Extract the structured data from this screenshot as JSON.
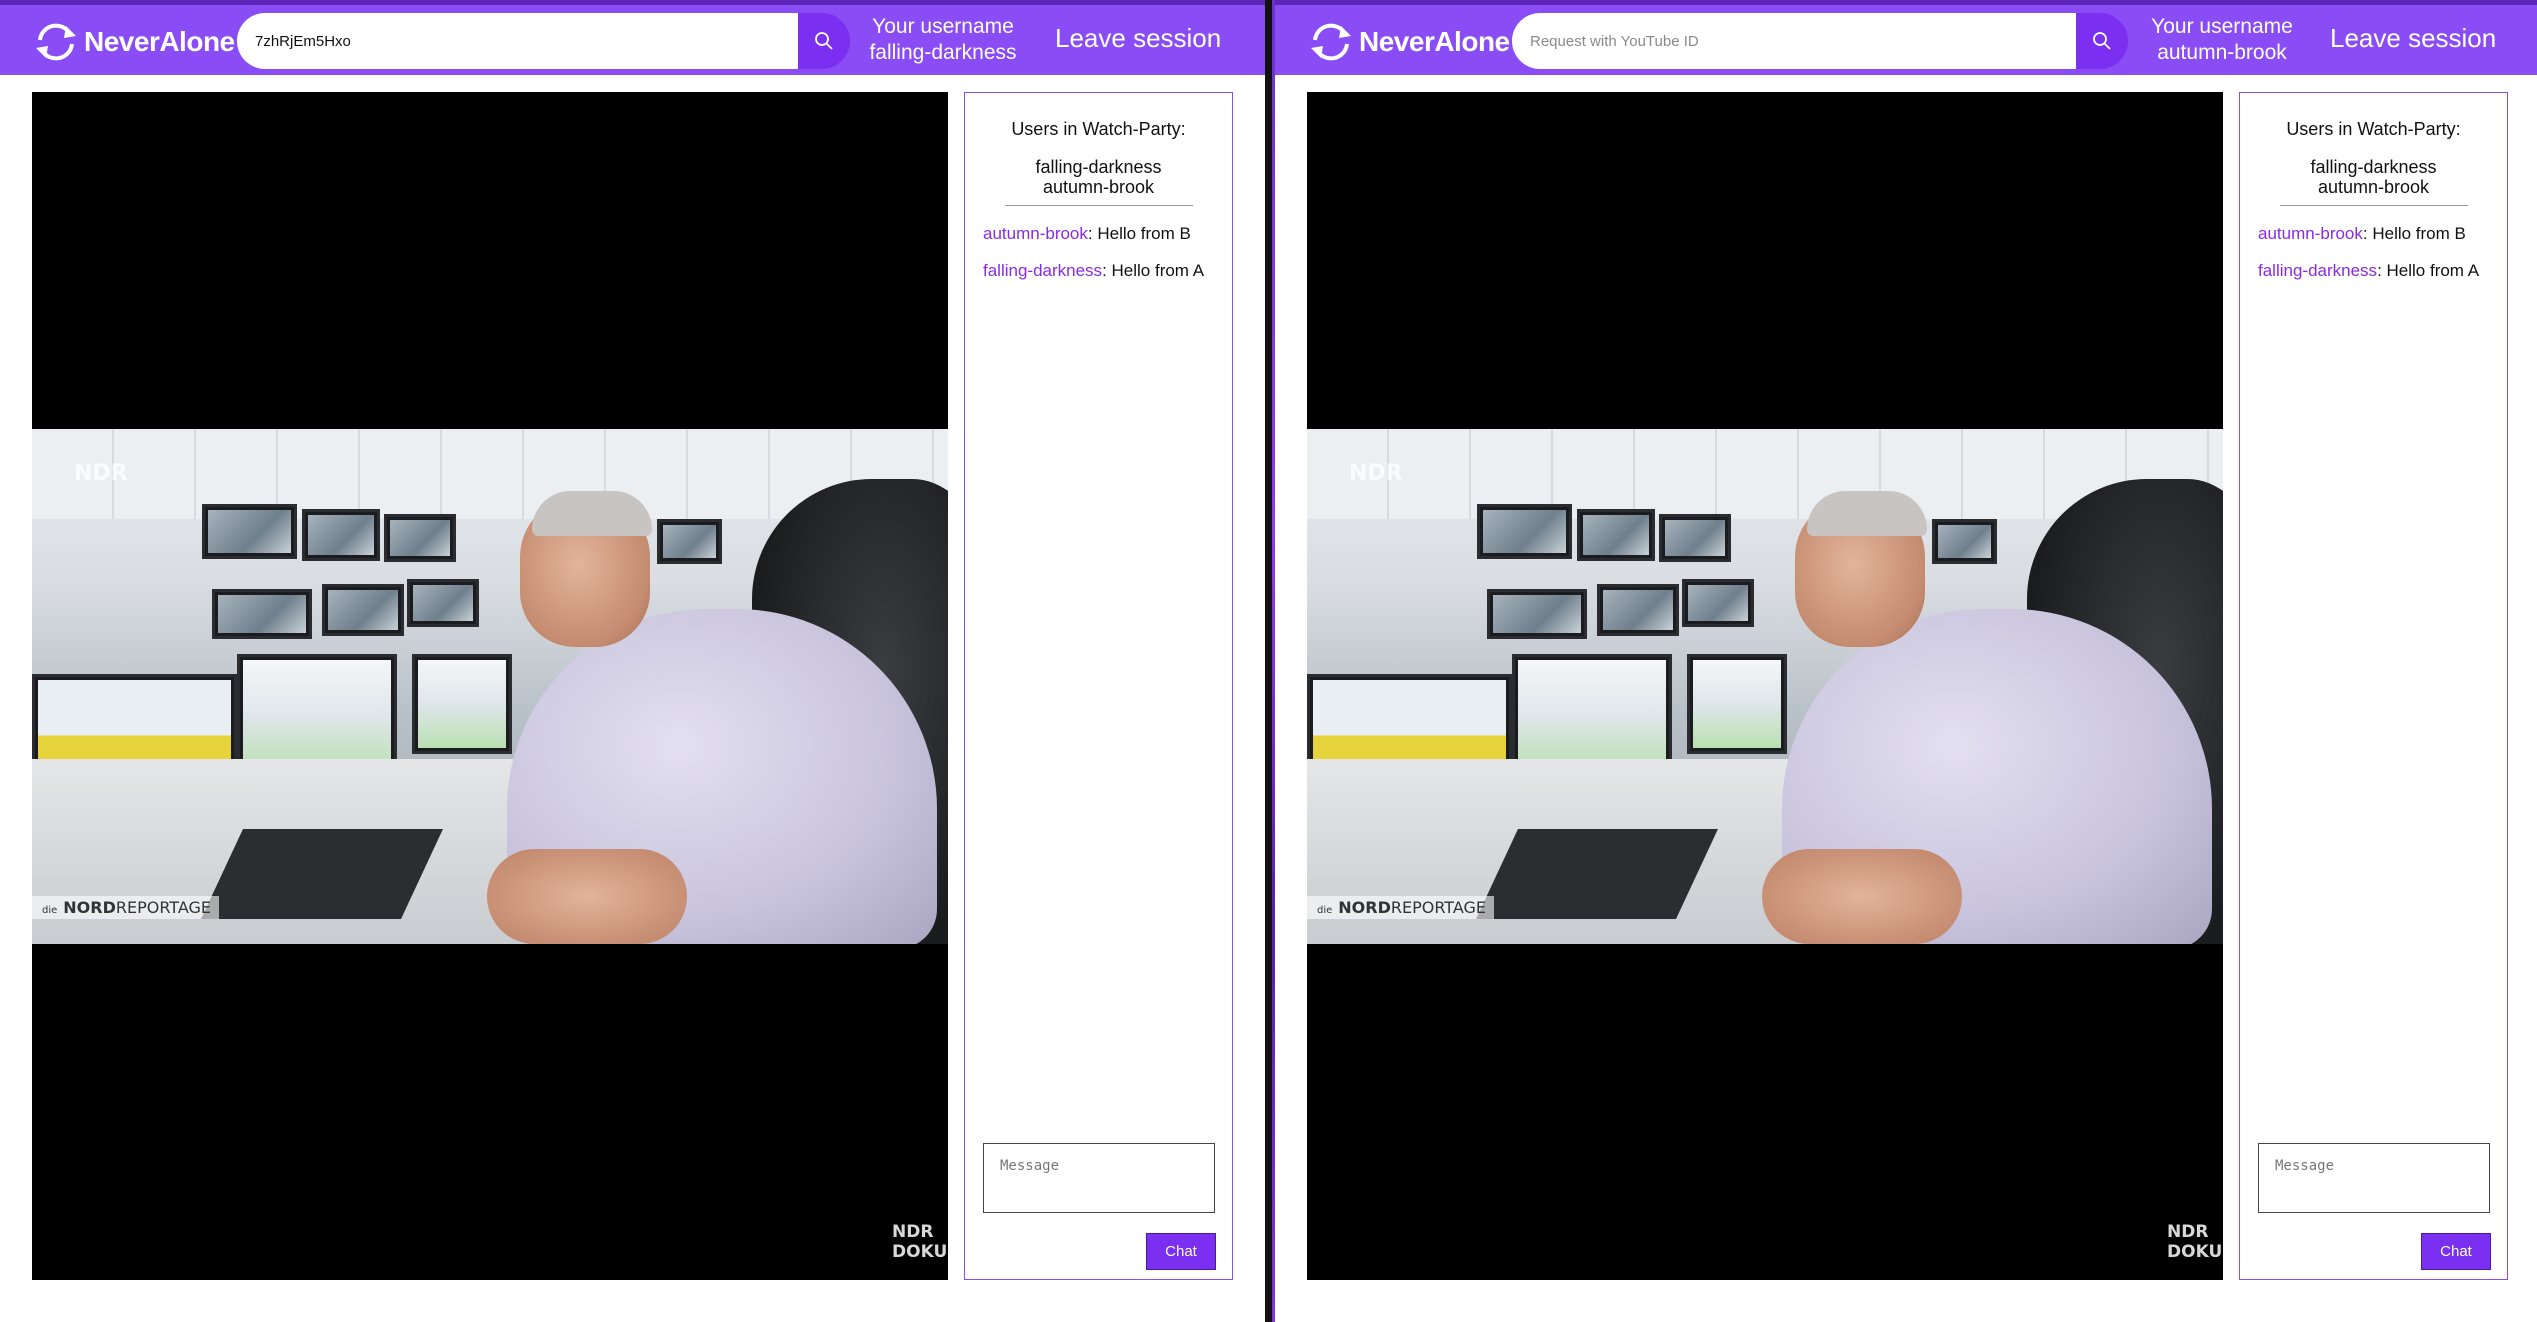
{
  "app": {
    "name": "NeverAlone",
    "leave_label": "Leave session",
    "username_caption": "Your username"
  },
  "colors": {
    "brand": "#8a4cf5",
    "accent": "#7b2ff0",
    "author": "#8a2be2"
  },
  "sessions": [
    {
      "search": {
        "value": "7zhRjEm5Hxo",
        "placeholder": "Request with YouTube ID"
      },
      "username": "falling-darkness",
      "video": {
        "watermark": "NDR",
        "badge_prefix": "die",
        "badge_strong": "NORD",
        "badge_rest": "REPORTAGE",
        "corner_line1": "NDR",
        "corner_line2": "DOKU"
      },
      "panel": {
        "users_title": "Users in Watch-Party:",
        "users": [
          "falling-darkness",
          "autumn-brook"
        ],
        "messages": [
          {
            "author": "autumn-brook",
            "text": ": Hello from B"
          },
          {
            "author": "falling-darkness",
            "text": ": Hello from A"
          }
        ],
        "message_placeholder": "Message",
        "chat_label": "Chat"
      }
    },
    {
      "search": {
        "value": "",
        "placeholder": "Request with YouTube ID"
      },
      "username": "autumn-brook",
      "video": {
        "watermark": "NDR",
        "badge_prefix": "die",
        "badge_strong": "NORD",
        "badge_rest": "REPORTAGE",
        "corner_line1": "NDR",
        "corner_line2": "DOKU"
      },
      "panel": {
        "users_title": "Users in Watch-Party:",
        "users": [
          "falling-darkness",
          "autumn-brook"
        ],
        "messages": [
          {
            "author": "autumn-brook",
            "text": ": Hello from B"
          },
          {
            "author": "falling-darkness",
            "text": ": Hello from A"
          }
        ],
        "message_placeholder": "Message",
        "chat_label": "Chat"
      }
    }
  ]
}
